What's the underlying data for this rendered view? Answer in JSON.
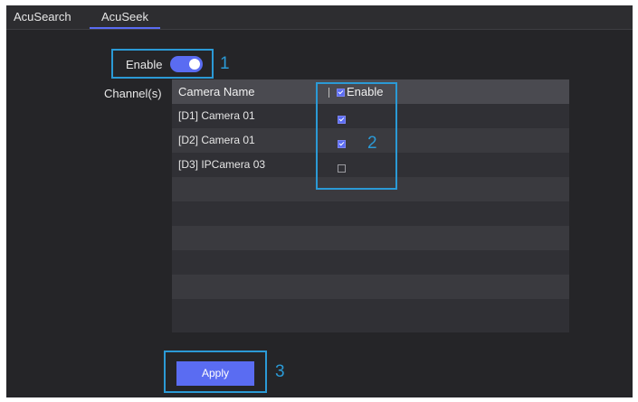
{
  "tabs": [
    {
      "label": "AcuSearch"
    },
    {
      "label": "AcuSeek",
      "active": true
    }
  ],
  "enable": {
    "label": "Enable",
    "on": true
  },
  "channels_label": "Channel(s)",
  "table": {
    "header": {
      "name": "Camera Name",
      "enable": "Enable",
      "enable_all_checked": true
    },
    "rows": [
      {
        "name": "[D1] Camera 01",
        "enabled": true
      },
      {
        "name": "[D2] Camera 01",
        "enabled": true
      },
      {
        "name": "[D3] IPCamera 03",
        "enabled": false
      }
    ]
  },
  "apply_label": "Apply",
  "callouts": [
    "1",
    "2",
    "3"
  ],
  "colors": {
    "accent": "#5a6cf2",
    "callout": "#2b9ad6",
    "background": "#252528"
  }
}
